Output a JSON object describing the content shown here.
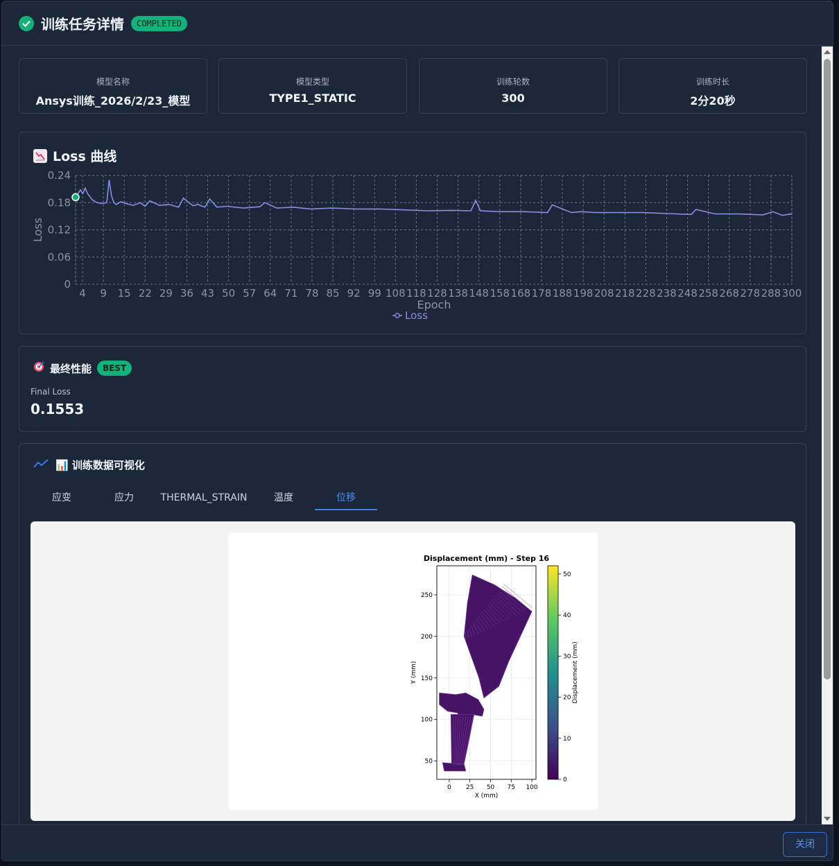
{
  "header": {
    "title": "训练任务详情",
    "status": "COMPLETED"
  },
  "stats": [
    {
      "label": "模型名称",
      "value": "Ansys训练_2026/2/23_模型"
    },
    {
      "label": "模型类型",
      "value": "TYPE1_STATIC"
    },
    {
      "label": "训练轮数",
      "value": "300"
    },
    {
      "label": "训练时长",
      "value": "2分20秒"
    }
  ],
  "loss_panel": {
    "title": "Loss 曲线"
  },
  "performance": {
    "title": "最终性能",
    "badge": "BEST",
    "metric_label": "Final Loss",
    "metric_value": "0.1553"
  },
  "viz_panel": {
    "title": "📊 训练数据可视化",
    "tabs": [
      "应变",
      "应力",
      "THERMAL_STRAIN",
      "温度",
      "位移"
    ],
    "active_tab": 4
  },
  "footer": {
    "close_label": "关闭"
  },
  "colors": {
    "accent": "#3d7be6",
    "success": "#13b27a",
    "loss_line": "#8a8fe6"
  },
  "chart_data": [
    {
      "type": "line",
      "xlabel": "Epoch",
      "ylabel": "Loss",
      "x_tick_labels": [
        "4",
        "9",
        "15",
        "22",
        "29",
        "36",
        "43",
        "50",
        "57",
        "64",
        "71",
        "78",
        "85",
        "92",
        "99",
        "108",
        "118",
        "128",
        "138",
        "148",
        "158",
        "168",
        "178",
        "188",
        "198",
        "208",
        "218",
        "228",
        "238",
        "248",
        "258",
        "268",
        "278",
        "288",
        "300"
      ],
      "y_tick_labels": [
        "0",
        "0.06",
        "0.12",
        "0.18",
        "0.24"
      ],
      "ylim": [
        0,
        0.24
      ],
      "xlim": [
        1,
        300
      ],
      "grid": true,
      "legend": "bottom-center",
      "series": [
        {
          "name": "Loss",
          "x": [
            1,
            2,
            3,
            4,
            5,
            6,
            8,
            10,
            12,
            14,
            15,
            16,
            17,
            18,
            20,
            22,
            25,
            28,
            30,
            32,
            36,
            40,
            44,
            46,
            50,
            52,
            55,
            57,
            60,
            64,
            71,
            78,
            80,
            85,
            92,
            99,
            108,
            118,
            128,
            138,
            148,
            158,
            166,
            168,
            170,
            178,
            188,
            198,
            200,
            208,
            212,
            218,
            228,
            238,
            248,
            258,
            260,
            268,
            278,
            288,
            292,
            296,
            300
          ],
          "y": [
            0.192,
            0.2,
            0.208,
            0.2,
            0.212,
            0.2,
            0.186,
            0.18,
            0.178,
            0.18,
            0.23,
            0.195,
            0.18,
            0.176,
            0.182,
            0.178,
            0.174,
            0.18,
            0.172,
            0.184,
            0.174,
            0.176,
            0.17,
            0.19,
            0.173,
            0.176,
            0.17,
            0.188,
            0.17,
            0.172,
            0.168,
            0.171,
            0.18,
            0.168,
            0.17,
            0.166,
            0.168,
            0.166,
            0.166,
            0.164,
            0.162,
            0.163,
            0.162,
            0.185,
            0.162,
            0.16,
            0.16,
            0.158,
            0.175,
            0.158,
            0.16,
            0.158,
            0.158,
            0.158,
            0.156,
            0.154,
            0.165,
            0.155,
            0.155,
            0.153,
            0.16,
            0.152,
            0.1553
          ]
        }
      ]
    },
    {
      "type": "heatmap",
      "title": "Displacement (mm) - Step 16",
      "xlabel": "X (mm)",
      "ylabel": "Y (mm)",
      "colorbar_label": "Displacement (mm)",
      "x_tick_labels": [
        "0",
        "25",
        "50",
        "75",
        "100"
      ],
      "y_tick_labels": [
        "50",
        "100",
        "150",
        "200",
        "250"
      ],
      "colorbar_tick_labels": [
        "0",
        "10",
        "20",
        "30",
        "40",
        "50"
      ],
      "colorbar_range": [
        0,
        52
      ],
      "colormap": "viridis",
      "xlim": [
        -15,
        105
      ],
      "ylim": [
        28,
        285
      ]
    }
  ]
}
